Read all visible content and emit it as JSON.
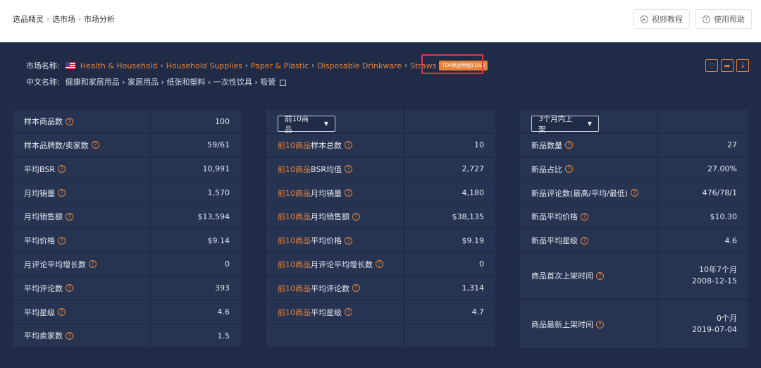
{
  "breadcrumb": [
    "选品精灵",
    "选市场",
    "市场分析"
  ],
  "top_buttons": {
    "video": "视频教程",
    "help": "使用帮助"
  },
  "market": {
    "label": "市场名称:",
    "path": [
      "Health & Household",
      "Household Supplies",
      "Paper & Plastic",
      "Disposable Drinkware",
      "Straws"
    ],
    "badge": "TOP商品明细(100)",
    "cn_label": "中文名称:",
    "cn_path": "健康和家居用品 › 家居用品 › 纸张和塑料 › 一次性饮具 › 吸管"
  },
  "panel1": {
    "rows": [
      {
        "label": "样本商品数",
        "value": "100"
      },
      {
        "label": "样本品牌数/卖家数",
        "value": "59/61"
      },
      {
        "label": "平均BSR",
        "value": "10,991"
      },
      {
        "label": "月均销量",
        "value": "1,570"
      },
      {
        "label": "月均销售额",
        "value": "$13,594"
      },
      {
        "label": "平均价格",
        "value": "$9.14"
      },
      {
        "label": "月评论平均增长数",
        "value": "0"
      },
      {
        "label": "平均评论数",
        "value": "393"
      },
      {
        "label": "平均星级",
        "value": "4.6"
      },
      {
        "label": "平均卖家数",
        "value": "1.5"
      }
    ]
  },
  "panel2": {
    "dropdown": "前10商品",
    "prefix": "前10商品",
    "rows": [
      {
        "label": "样本总数",
        "value": "10"
      },
      {
        "label": "BSR均值",
        "value": "2,727"
      },
      {
        "label": "月均销量",
        "value": "4,180"
      },
      {
        "label": "月均销售额",
        "value": "$38,135"
      },
      {
        "label": "平均价格",
        "value": "$9.19"
      },
      {
        "label": "月评论平均增长数",
        "value": "0"
      },
      {
        "label": "平均评论数",
        "value": "1,314"
      },
      {
        "label": "平均星级",
        "value": "4.7"
      }
    ]
  },
  "panel3": {
    "dropdown": "3个月内上架",
    "rows": [
      {
        "label": "新品数量",
        "value": "27"
      },
      {
        "label": "新品占比",
        "value": "27.00%"
      },
      {
        "label": "新品评论数(最高/平均/最低)",
        "value": "476/78/1"
      },
      {
        "label": "新品平均价格",
        "value": "$10.30"
      },
      {
        "label": "新品平均星级",
        "value": "4.6"
      }
    ],
    "first_listed": {
      "label": "商品首次上架时间",
      "line1": "10年7个月",
      "line2": "2008-12-15"
    },
    "latest_listed": {
      "label": "商品最新上架时间",
      "line1": "0个月",
      "line2": "2019-07-04"
    }
  },
  "colors": {
    "background": "#1f2b47",
    "cell": "#263452",
    "accent": "#e5833b",
    "highlight": "#e0334a"
  }
}
